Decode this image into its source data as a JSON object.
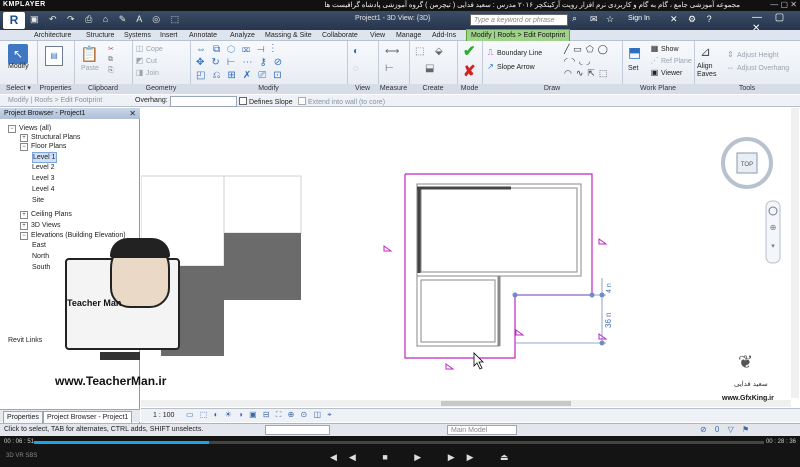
{
  "player": {
    "logo": "KMPLAYER",
    "title": "مجموعه آموزشی جامع ، گام به گام و کاربردی نرم افزار رویت آرکیتکچر ۲۰۱۶  مدرس : سعید فدایی ( تیچرمن ) گروه آموزشی پادشاه گرافیست ها",
    "controls": "— ▢ ✕",
    "time_current": "00 : 06 : 51",
    "time_total": "00 : 28 : 36",
    "progress": 0.24,
    "playback_icons": "◀◀ ■ ▶ ▶▶ ⏏",
    "left_icons": "3D  VR  SBS"
  },
  "app": {
    "app_button": "R",
    "doc_title": "Project1 - 3D View: {3D}",
    "search_placeholder": "Type a keyword or phrase",
    "signin": "Sign In",
    "qat_icons": "▣ ↶ ↷ ⎙ ⌂ ✎ A ◎ ⬚",
    "win_controls": "— ▢ ✕"
  },
  "tabs": [
    "Architecture",
    "Structure",
    "Systems",
    "Insert",
    "Annotate",
    "Analyze",
    "Massing & Site",
    "Collaborate",
    "View",
    "Manage",
    "Add-Ins",
    "Modify | Roofs > Edit Footprint"
  ],
  "ribbon": {
    "select_panel": {
      "title": "Select ▾",
      "modify": "Modify"
    },
    "properties_panel": {
      "title": "Properties"
    },
    "clipboard_panel": {
      "title": "Clipboard",
      "paste": "Paste"
    },
    "geometry_panel": {
      "title": "Geometry",
      "cope": "Cope",
      "cut": "Cut",
      "join": "Join"
    },
    "modify_panel": {
      "title": "Modify"
    },
    "view_panel": {
      "title": "View"
    },
    "measure_panel": {
      "title": "Measure"
    },
    "create_panel": {
      "title": "Create"
    },
    "mode_panel": {
      "title": "Mode"
    },
    "draw_panel": {
      "title": "Draw",
      "boundary": "Boundary Line",
      "slope": "Slope Arrow"
    },
    "workplane_panel": {
      "title": "Work Plane",
      "set": "Set",
      "show": "Show",
      "ref_plane": "Ref Plane",
      "viewer": "Viewer"
    },
    "tools_panel": {
      "title": "Tools",
      "align": "Align Eaves",
      "adjust_height": "Adjust Height",
      "adjust_overhang": "Adjust Overhang"
    }
  },
  "options_bar": {
    "context": "Modify | Roofs > Edit Footprint",
    "overhang_label": "Overhang:",
    "defines_slope": "Defines Slope",
    "extend_core": "Extend into wall (to core)"
  },
  "browser": {
    "title": "Project Browser - Project1",
    "items": [
      {
        "label": "Views (all)",
        "level": 0,
        "tog": "−"
      },
      {
        "label": "Structural Plans",
        "level": 1,
        "tog": "+"
      },
      {
        "label": "Floor Plans",
        "level": 1,
        "tog": "−"
      },
      {
        "label": "Level 1",
        "level": 2,
        "tog": ""
      },
      {
        "label": "Level 2",
        "level": 2,
        "tog": ""
      },
      {
        "label": "Level 3",
        "level": 2,
        "tog": ""
      },
      {
        "label": "Level 4",
        "level": 2,
        "tog": ""
      },
      {
        "label": "Site",
        "level": 2,
        "tog": ""
      },
      {
        "label": "Ceiling Plans",
        "level": 1,
        "tog": "+"
      },
      {
        "label": "3D Views",
        "level": 1,
        "tog": "+"
      },
      {
        "label": "Elevations (Building Elevation)",
        "level": 1,
        "tog": "−"
      },
      {
        "label": "East",
        "level": 2,
        "tog": ""
      },
      {
        "label": "North",
        "level": 2,
        "tog": ""
      },
      {
        "label": "South",
        "level": 2,
        "tog": ""
      },
      {
        "label": "Revit Links",
        "level": 0,
        "tog": ""
      }
    ],
    "tab_properties": "Properties",
    "tab_browser": "Project Browser - Project1"
  },
  "view": {
    "scale": "1 : 100",
    "dimension": "36 n",
    "dimension_small": "4 n",
    "viewcube_label": "TOP"
  },
  "status": {
    "text": "Click to select, TAB for alternates, CTRL adds, SHIFT unselects.",
    "model": "Main Model",
    "right_icons": "⊘ 0 ▽ ⚑"
  },
  "watermark": {
    "teacher_url": "www.TeacherMan.ir",
    "teacher_name": "Teacher Man",
    "gfx_url": "www.GfxKing.ir",
    "gfx_name": "سعید فدایی"
  },
  "colors": {
    "footprint": "#c026c0",
    "context_tab": "#9fd38a",
    "dimension": "#4a6fb0"
  }
}
